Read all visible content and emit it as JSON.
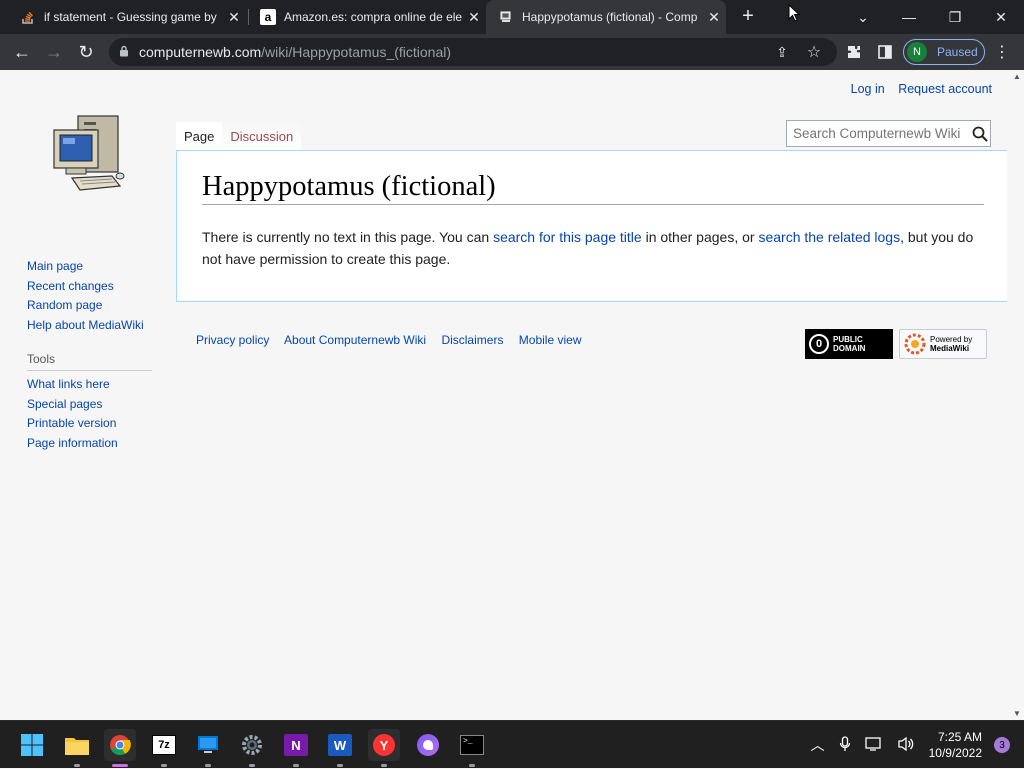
{
  "browser": {
    "tabs": [
      {
        "title": "if statement - Guessing game by",
        "icon": "stackoverflow-icon"
      },
      {
        "title": "Amazon.es: compra online de ele",
        "icon": "amazon-icon"
      },
      {
        "title": "Happypotamus (fictional) - Comp",
        "icon": "computernewb-icon",
        "active": true
      }
    ],
    "new_tab_label": "+",
    "url_host": "computernewb.com",
    "url_path": "/wiki/Happypotamus_(fictional)",
    "profile_initial": "N",
    "profile_status": "Paused"
  },
  "wiki": {
    "personal": {
      "login": "Log in",
      "request": "Request account"
    },
    "tabs": {
      "page": "Page",
      "discussion": "Discussion"
    },
    "search_placeholder": "Search Computernewb Wiki",
    "title": "Happypotamus (fictional)",
    "body": {
      "t1": "There is currently no text in this page. You can ",
      "link1": "search for this page title",
      "t2": " in other pages, or ",
      "link2": "search the related logs",
      "t3": ", but you do not have permission to create this page."
    },
    "nav": [
      "Main page",
      "Recent changes",
      "Random page",
      "Help about MediaWiki"
    ],
    "tools_heading": "Tools",
    "tools": [
      "What links here",
      "Special pages",
      "Printable version",
      "Page information"
    ],
    "footer": [
      "Privacy policy",
      "About Computernewb Wiki",
      "Disclaimers",
      "Mobile view"
    ],
    "badge_pd": [
      "PUBLIC",
      "DOMAIN"
    ],
    "badge_mw": [
      "Powered by",
      "MediaWiki"
    ]
  },
  "taskbar": {
    "time": "7:25 AM",
    "date": "10/9/2022",
    "notifications": "3",
    "apps": [
      "start-icon",
      "file-explorer-icon",
      "chrome-icon",
      "7zip-icon",
      "remote-desktop-icon",
      "settings-icon",
      "onenote-icon",
      "word-icon",
      "yandex-icon",
      "messenger-icon",
      "terminal-icon"
    ]
  }
}
